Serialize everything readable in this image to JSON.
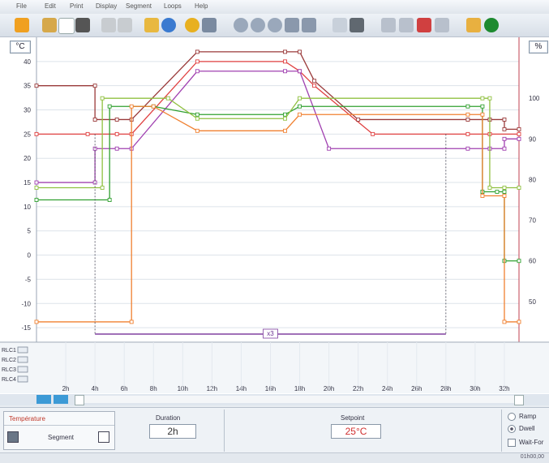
{
  "menu": [
    "File",
    "Edit",
    "Print",
    "Display",
    "Segment",
    "Loops",
    "Help"
  ],
  "toolbar_icons": [
    "back-icon",
    "open-icon",
    "new-icon",
    "save-icon",
    "undo-icon",
    "redo-icon",
    "edit-icon",
    "info-icon",
    "settings-icon",
    "tools-icon",
    "zoom-icon",
    "zoom-in-icon",
    "zoom-out-icon",
    "pan-horizontal-icon",
    "pan-vertical-icon",
    "export-icon",
    "calendar-icon",
    "link-icon",
    "unlink-icon",
    "cut-icon",
    "delete-icon",
    "hand-icon",
    "run-icon"
  ],
  "units": {
    "left": "°C",
    "right": "%"
  },
  "y_left_ticks": [
    "40",
    "35",
    "30",
    "25",
    "20",
    "15",
    "10",
    "5",
    "0",
    "-5",
    "-10",
    "-15"
  ],
  "y_right_ticks": [
    "100",
    "90",
    "80",
    "70",
    "60",
    "50"
  ],
  "x_ticks": [
    "2h",
    "4h",
    "6h",
    "8h",
    "10h",
    "12h",
    "14h",
    "16h",
    "18h",
    "20h",
    "22h",
    "24h",
    "26h",
    "28h",
    "30h",
    "32h"
  ],
  "relays": [
    "RLC1",
    "RLC2",
    "RLC3",
    "RLC4"
  ],
  "loop_label": "x3",
  "colors": {
    "red": "#e04040",
    "darkred": "#9a3a3a",
    "purple": "#a040b0",
    "green": "#30a030",
    "lightgreen": "#90c040",
    "orange": "#f08030"
  },
  "chart_data": {
    "type": "line",
    "x_unit": "h",
    "xlim": [
      0,
      33
    ],
    "ylim_left": [
      -18,
      45
    ],
    "ylim_right": [
      40,
      115
    ],
    "series": [
      {
        "color": "red",
        "axis": "left",
        "points": [
          [
            0,
            25
          ],
          [
            3.5,
            25
          ],
          [
            5.5,
            25
          ],
          [
            6.5,
            25
          ],
          [
            11,
            40
          ],
          [
            17,
            40
          ],
          [
            18,
            38
          ],
          [
            19,
            35
          ],
          [
            23,
            25
          ],
          [
            29.5,
            25
          ],
          [
            31,
            25
          ],
          [
            33,
            25
          ]
        ]
      },
      {
        "color": "darkred",
        "axis": "left",
        "points": [
          [
            0,
            35
          ],
          [
            4,
            35
          ],
          [
            4,
            28
          ],
          [
            5.5,
            28
          ],
          [
            6.5,
            28
          ],
          [
            11,
            42
          ],
          [
            17,
            42
          ],
          [
            18,
            42
          ],
          [
            19,
            36
          ],
          [
            22,
            28
          ],
          [
            29.5,
            28
          ],
          [
            31,
            28
          ],
          [
            32,
            28
          ],
          [
            32,
            26
          ],
          [
            33,
            26
          ]
        ]
      },
      {
        "color": "purple",
        "axis": "left",
        "points": [
          [
            0,
            15
          ],
          [
            4,
            15
          ],
          [
            4,
            22
          ],
          [
            5.5,
            22
          ],
          [
            6.5,
            22
          ],
          [
            11,
            38
          ],
          [
            17,
            38
          ],
          [
            18,
            38
          ],
          [
            20,
            22
          ],
          [
            29.5,
            22
          ],
          [
            31,
            22
          ],
          [
            32,
            22
          ],
          [
            32,
            24
          ],
          [
            33,
            24
          ]
        ]
      },
      {
        "color": "green",
        "axis": "right",
        "points": [
          [
            0,
            75
          ],
          [
            5,
            75
          ],
          [
            5,
            98
          ],
          [
            8,
            98
          ],
          [
            11,
            96
          ],
          [
            17,
            96
          ],
          [
            18,
            98
          ],
          [
            29.5,
            98
          ],
          [
            30.5,
            98
          ],
          [
            30.5,
            77
          ],
          [
            31.5,
            77
          ],
          [
            32,
            77
          ],
          [
            32,
            60
          ],
          [
            33,
            60
          ]
        ]
      },
      {
        "color": "lightgreen",
        "axis": "right",
        "points": [
          [
            0,
            78
          ],
          [
            4.5,
            78
          ],
          [
            4.5,
            100
          ],
          [
            9,
            100
          ],
          [
            11,
            95
          ],
          [
            17,
            95
          ],
          [
            18,
            100
          ],
          [
            30.5,
            100
          ],
          [
            31,
            100
          ],
          [
            31,
            78
          ],
          [
            32,
            78
          ],
          [
            33,
            78
          ]
        ]
      },
      {
        "color": "orange",
        "axis": "right",
        "points": [
          [
            0,
            45
          ],
          [
            6.5,
            45
          ],
          [
            6.5,
            98
          ],
          [
            8,
            98
          ],
          [
            11,
            92
          ],
          [
            17,
            92
          ],
          [
            18,
            96
          ],
          [
            29.5,
            96
          ],
          [
            30.5,
            96
          ],
          [
            30.5,
            76
          ],
          [
            32,
            76
          ],
          [
            32,
            45
          ],
          [
            33,
            45
          ]
        ]
      }
    ]
  },
  "bottom": {
    "tab_label": "Température",
    "segment_label": "Segment",
    "duration_label": "Duration",
    "duration_value": "2h",
    "setpoint_label": "Setpoint",
    "setpoint_value": "25°C",
    "ramp_label": "Ramp",
    "dwell_label": "Dwell",
    "waitfor_label": "Wait-For"
  },
  "status_text": "01h00,00"
}
